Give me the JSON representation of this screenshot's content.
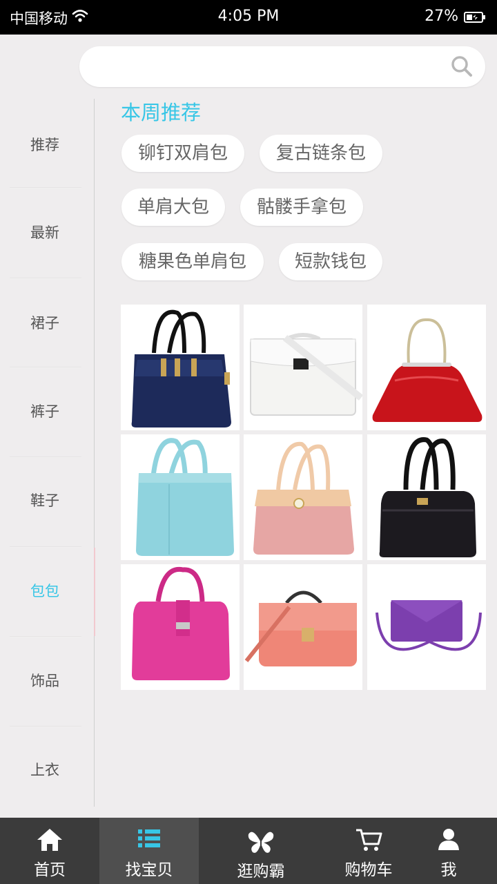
{
  "status_bar": {
    "carrier": "中国移动",
    "time": "4:05 PM",
    "battery": "27%"
  },
  "search": {
    "placeholder": "",
    "icon": "search-icon"
  },
  "sidebar": {
    "items": [
      {
        "label": "推荐",
        "active": false
      },
      {
        "label": "最新",
        "active": false
      },
      {
        "label": "裙子",
        "active": false
      },
      {
        "label": "裤子",
        "active": false
      },
      {
        "label": "鞋子",
        "active": false
      },
      {
        "label": "包包",
        "active": true
      },
      {
        "label": "饰品",
        "active": false
      },
      {
        "label": "上衣",
        "active": false
      }
    ]
  },
  "main": {
    "section_title": "本周推荐",
    "tags": [
      "铆钉双肩包",
      "复古链条包",
      "单肩大包",
      "骷髅手拿包",
      "糖果色单肩包",
      "短款钱包"
    ],
    "products": [
      {
        "name": "navy-handbag",
        "color": "#1d2a5a"
      },
      {
        "name": "white-handbag",
        "color": "#f4f4f2"
      },
      {
        "name": "red-clutch",
        "color": "#c8141b"
      },
      {
        "name": "light-blue-tote",
        "color": "#8fd3de"
      },
      {
        "name": "pink-handbag",
        "color": "#e6a6a4"
      },
      {
        "name": "black-handbag",
        "color": "#1c1a1f"
      },
      {
        "name": "magenta-handbag",
        "color": "#e23c9a"
      },
      {
        "name": "coral-satchel",
        "color": "#ef8677"
      },
      {
        "name": "purple-clutch",
        "color": "#7c3fae"
      }
    ]
  },
  "bottom_nav": {
    "items": [
      {
        "label": "首页",
        "icon": "home-icon",
        "active": false
      },
      {
        "label": "找宝贝",
        "icon": "list-icon",
        "active": true
      },
      {
        "label": "逛购霸",
        "icon": "butterfly-icon",
        "active": false
      },
      {
        "label": "购物车",
        "icon": "cart-icon",
        "active": false
      },
      {
        "label": "我",
        "icon": "user-icon",
        "active": false
      }
    ]
  },
  "colors": {
    "accent": "#37c6e6",
    "background": "#efedee",
    "nav_background": "#3b3b3b"
  }
}
